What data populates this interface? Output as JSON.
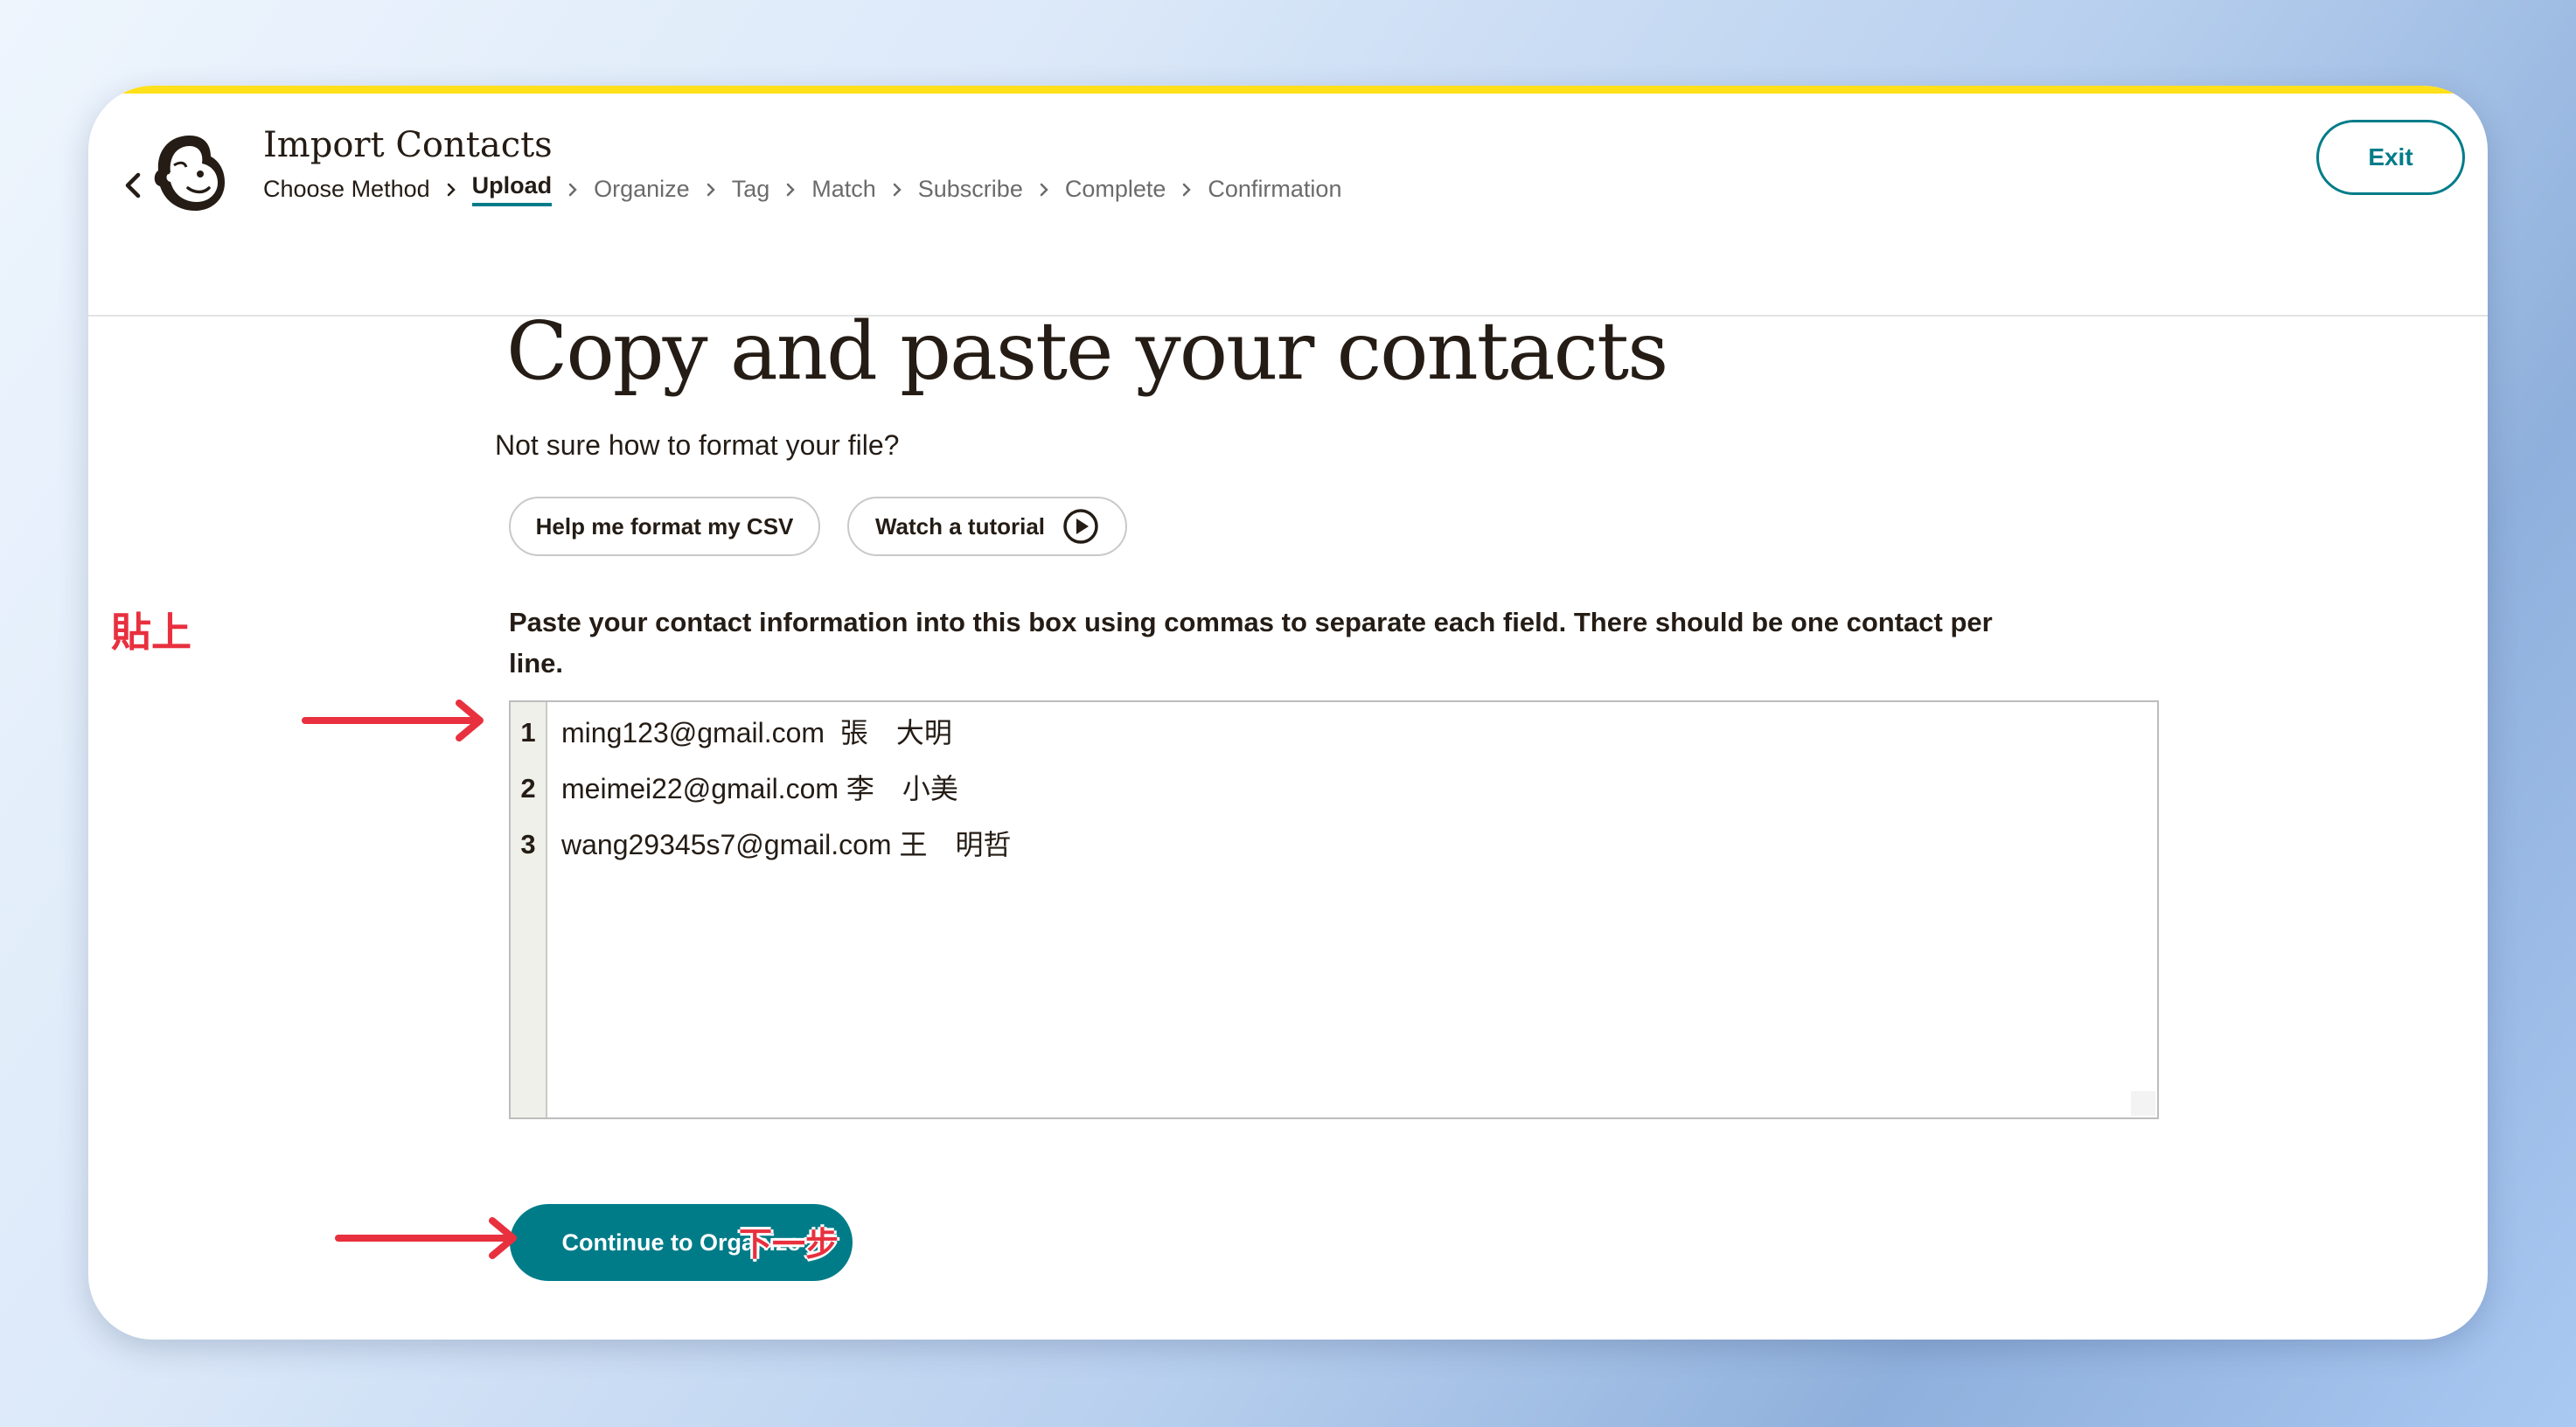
{
  "header": {
    "title": "Import Contacts",
    "exit_label": "Exit",
    "breadcrumbs": [
      "Choose Method",
      "Upload",
      "Organize",
      "Tag",
      "Match",
      "Subscribe",
      "Complete",
      "Confirmation"
    ],
    "active_step": "Upload"
  },
  "main": {
    "heading": "Copy and paste your contacts",
    "subtext": "Not sure how to format your file?",
    "help_button_label": "Help me format my CSV",
    "tutorial_button_label": "Watch a tutorial",
    "instructions": "Paste your contact information into this box using commas to separate each field. There should be one contact per line.",
    "editor": {
      "line_numbers": [
        "1",
        "2",
        "3"
      ],
      "lines": [
        "ming123@gmail.com  張　大明",
        "meimei22@gmail.com 李　小美",
        "wang29345s7@gmail.com 王　明哲"
      ]
    },
    "continue_label": "Continue to Organize"
  },
  "annotations": {
    "paste_label": "貼上",
    "next_label": "下一步",
    "color": "#e8303e"
  },
  "colors": {
    "accent": "#007c89",
    "brand_bar": "#ffe01b",
    "text": "#241c15"
  },
  "icons": [
    "chevron-left-icon",
    "mailchimp-logo-icon",
    "chevron-right-icon",
    "play-circle-icon"
  ]
}
